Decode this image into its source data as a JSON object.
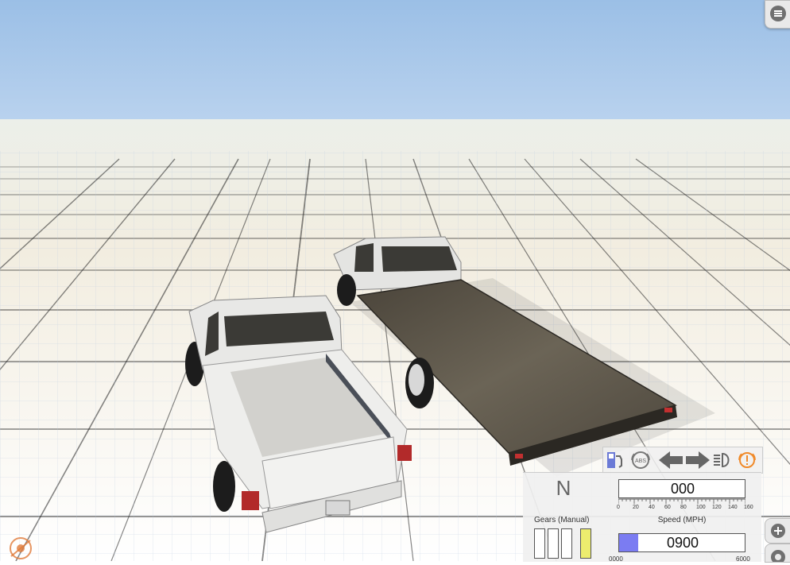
{
  "hud": {
    "gear": "N",
    "gears_label": "Gears (Manual)",
    "speed_value": "000",
    "speed_label": "Speed (MPH)",
    "speed_ticks": [
      "0",
      "20",
      "40",
      "60",
      "80",
      "100",
      "120",
      "140",
      "160"
    ],
    "rpm_value": "0900",
    "rpm_fill_fraction": 0.15,
    "rpm_min": "0000",
    "rpm_max": "6000",
    "abs_label": "ABS",
    "active_gear_box": 4
  },
  "icons": {
    "menu": "menu-icon",
    "fuel": "fuel-icon",
    "abs": "abs-icon",
    "left_signal": "left-arrow-icon",
    "right_signal": "right-arrow-icon",
    "headlight": "headlight-icon",
    "warning": "warning-icon",
    "add": "plus-icon",
    "settings": "gear-icon",
    "logo": "logo-icon"
  },
  "colors": {
    "sky_top": "#9bbfe6",
    "rpm_fill": "#7b7cf2",
    "gear_active": "#ecec6e",
    "warning": "#f08a2a"
  }
}
